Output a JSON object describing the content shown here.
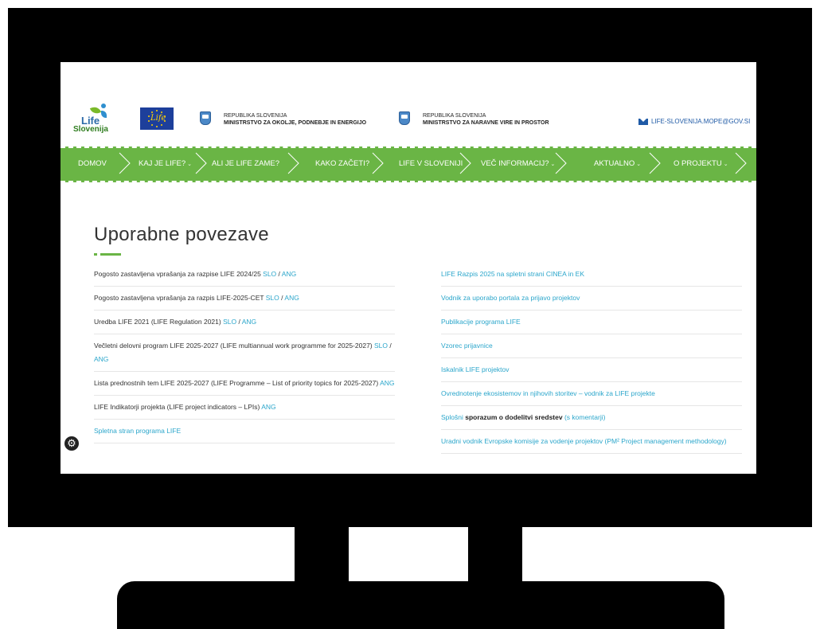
{
  "header": {
    "logo_word": "Life",
    "logo_sub": "Slovenija",
    "eu_life_text": "Life",
    "ministry1": {
      "line1": "REPUBLIKA SLOVENIJA",
      "line2": "MINISTRSTVO ZA OKOLJE,  PODNEBJE IN ENERGIJO"
    },
    "ministry2": {
      "line1": "REPUBLIKA SLOVENIJA",
      "line2": "MINISTRSTVO ZA NARAVNE VIRE IN PROSTOR"
    },
    "email": "LIFE-SLOVENIJA.MOPE@GOV.SI"
  },
  "nav": {
    "items": [
      {
        "label": "DOMOV",
        "caret": ""
      },
      {
        "label": "KAJ JE LIFE?",
        "caret": "⌄"
      },
      {
        "label": "ALI JE LIFE ZAME?",
        "caret": ""
      },
      {
        "label": "KAKO ZAČETI?",
        "caret": ""
      },
      {
        "label": "LIFE V SLOVENIJI",
        "caret": ""
      },
      {
        "label": "VEČ INFORMACIJ?",
        "caret": "⌄"
      },
      {
        "label": "AKTUALNO",
        "caret": "⌄"
      },
      {
        "label": "O PROJEKTU",
        "caret": "⌄"
      }
    ]
  },
  "main": {
    "title": "Uporabne povezave",
    "left_links": [
      {
        "text": "Pogosto zastavljena vprašanja za razpise LIFE 2024/25 ",
        "slo": "SLO",
        "sep": " / ",
        "ang": "ANG"
      },
      {
        "text": "Pogosto zastavljena vprašanja za razpis LIFE-2025-CET ",
        "slo": "SLO",
        "sep": " / ",
        "ang": "ANG"
      },
      {
        "text": "Uredba LIFE 2021 (LIFE Regulation 2021) ",
        "slo": "SLO",
        "sep": " / ",
        "ang": "ANG"
      },
      {
        "text": "Večletni delovni program LIFE 2025-2027 (LIFE multiannual work programme for 2025-2027) ",
        "slo": "SLO",
        "sep": " / ",
        "ang": "ANG"
      },
      {
        "text": "Lista prednostnih tem LIFE 2025-2027 (LIFE Programme – List of priority topics for 2025-2027) ",
        "ang": "ANG"
      },
      {
        "text": "LIFE Indikatorji projekta (LIFE project indicators – LPIs) ",
        "ang": "ANG"
      },
      {
        "link": "Spletna stran programa LIFE"
      }
    ],
    "right_links": [
      {
        "link": "LIFE Razpis 2025 na spletni strani CINEA in EK"
      },
      {
        "link": "Vodnik za uporabo portala za prijavo projektov"
      },
      {
        "link": "Publikacije programa LIFE"
      },
      {
        "link": "Vzorec prijavnice"
      },
      {
        "link": "Iskalnik LIFE projektov"
      },
      {
        "link": "Ovrednotenje ekosistemov in njihovih storitev – vodnik za LIFE projekte"
      },
      {
        "pre": "Splošni ",
        "bold": "sporazum o dodelitvi sredstev",
        "post": " (s komentarji)"
      },
      {
        "link": "Uradni vodnik Evropske komisije za vodenje projektov (PM² Project management methodology)"
      }
    ]
  },
  "widgets": {
    "settings_icon": "gear-icon",
    "settings_glyph": "⚙"
  },
  "colors": {
    "nav_green": "#6ab545",
    "link_blue": "#2ba6cb",
    "monitor": "#000000"
  }
}
